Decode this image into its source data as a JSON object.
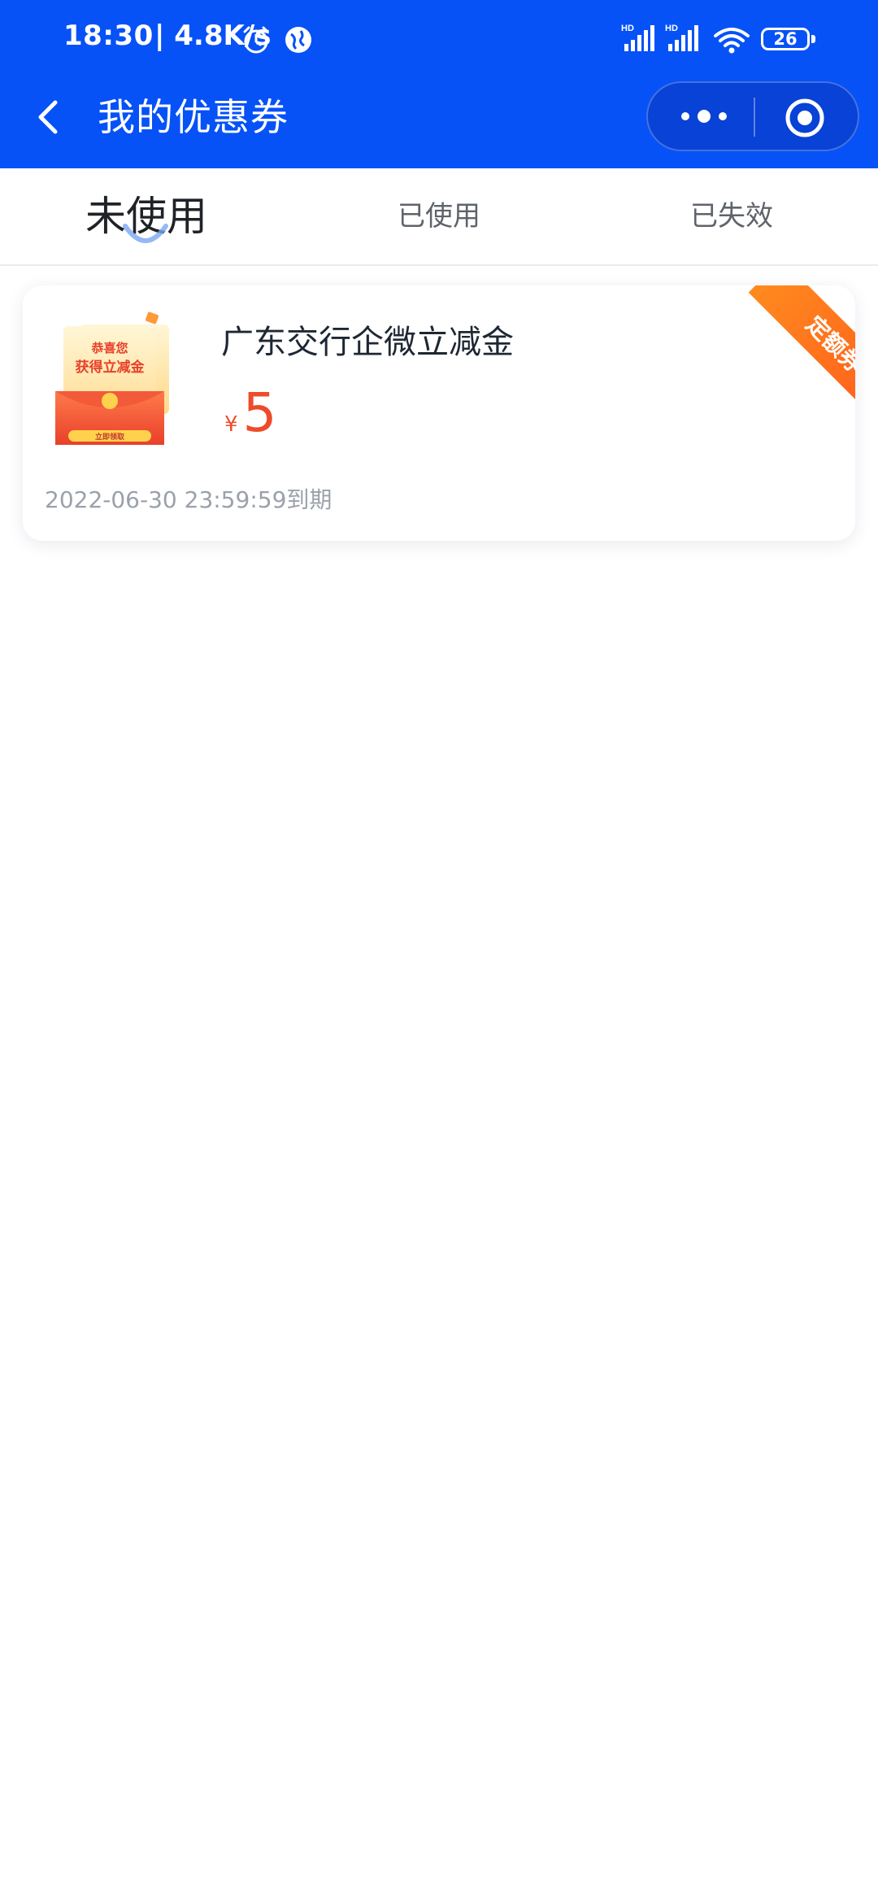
{
  "status_bar": {
    "time": "18:30",
    "speed": "| 4.8K/s",
    "signal_1_label": "HD",
    "signal_2_label": "HD",
    "battery": "26"
  },
  "header": {
    "title": "我的优惠券",
    "background": "#0652f7"
  },
  "tabs": [
    {
      "label": "未使用",
      "active": true
    },
    {
      "label": "已使用",
      "active": false
    },
    {
      "label": "已失效",
      "active": false
    }
  ],
  "coupon": {
    "name": "广东交行企微立减金",
    "currency": "¥",
    "amount": "5",
    "expiry": "2022-06-30 23:59:59到期",
    "ribbon": "定额券",
    "thumb_text_top": "恭喜您",
    "thumb_text_main": "获得立减金",
    "thumb_button": "立即领取",
    "accent": "#ee4b2b"
  },
  "icons": {
    "back": "chevron-left-icon",
    "more": "more-dots-icon",
    "close": "target-circle-icon",
    "alarm": "alarm-icon",
    "globe": "globe-icon",
    "signal": "signal-icon",
    "wifi": "wifi-icon",
    "battery": "battery-icon"
  }
}
